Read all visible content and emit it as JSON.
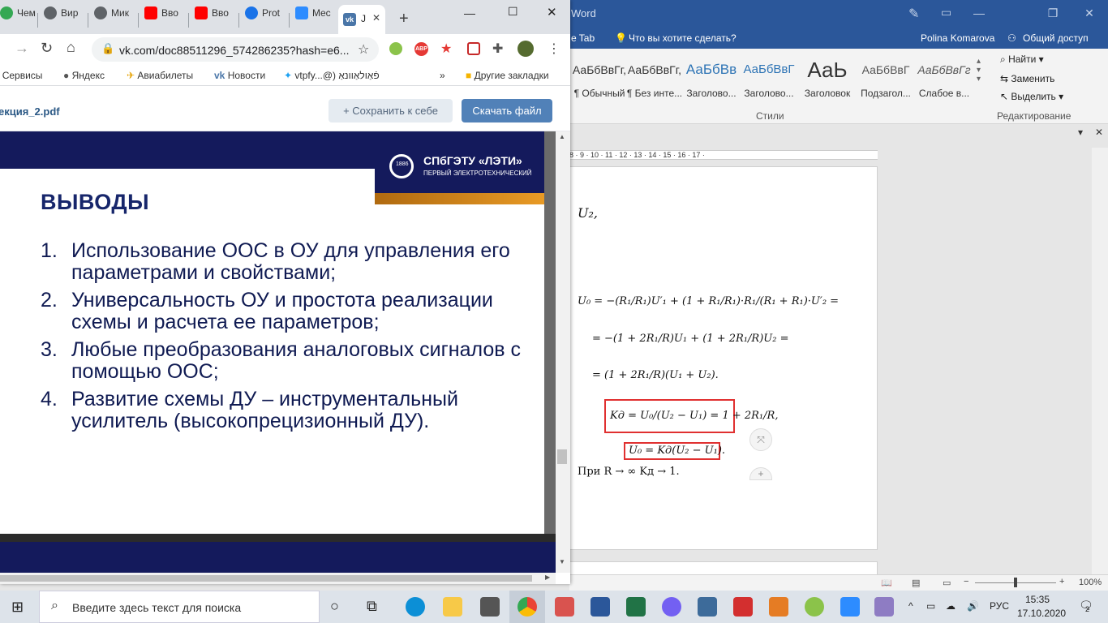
{
  "word": {
    "title_fragment": "Word",
    "tell_me": "Что вы хотите сделать?",
    "tab_fragment": "e Tab",
    "user": "Polina Komarova",
    "share": "Общий доступ",
    "styles": [
      {
        "sample": "АаБбВвГг,",
        "label": "¶ Обычный"
      },
      {
        "sample": "АаБбВвГг,",
        "label": "¶ Без инте..."
      },
      {
        "sample": "АаБбВв",
        "label": "Заголово..."
      },
      {
        "sample": "АаБбВвГ",
        "label": "Заголово..."
      },
      {
        "sample": "АаЬ",
        "label": "Заголовок"
      },
      {
        "sample": "АаБбВвГ",
        "label": "Подзагол..."
      },
      {
        "sample": "АаБбВвГг",
        "label": "Слабое в..."
      }
    ],
    "styles_group": "Стили",
    "editing": {
      "find": "Найти",
      "replace": "Заменить",
      "select": "Выделить",
      "group": "Редактирование"
    },
    "ruler": "8 · 9 · 10 · 11 · 12 · 13 · 14 · 15 · 16 · 17 ·",
    "equations": {
      "frag": "U₂,",
      "line1": "U₀ = −(R₁/R₁)U′₁ + (1 + R₁/R₁)·R₁/(R₁ + R₁)·U′₂ =",
      "line2": "= −(1 + 2R₁/R)U₁ + (1 + 2R₁/R)U₂ =",
      "line3": "= (1 + 2R₁/R)(U₁ + U₂).",
      "box1": "Kд = U₀/(U₂ − U₁) = 1 + 2R₁/R,",
      "box2": "U₀ = Kд(U₂ − U₁).",
      "note": "При R → ∞ Kд → 1."
    },
    "zoom": "100%"
  },
  "chrome": {
    "tabs": [
      "Чем",
      "Вир",
      "Мик",
      "Вво",
      "Вво",
      "Prot",
      "Mec",
      "J"
    ],
    "url": "vk.com/doc88511296_574286235?hash=e6...",
    "bookmarks": [
      "Сервисы",
      "Яндекс",
      "Авиабилеты",
      "Новости",
      "vtpfy...@) פֿאַולאַוונאַ",
      "Другие закладки"
    ],
    "file_name": "екция_2.pdf",
    "save_label": "Сохранить к себе",
    "download_label": "Скачать файл"
  },
  "slide": {
    "logo_title": "СПбГЭТУ «ЛЭТИ»",
    "logo_sub": "ПЕРВЫЙ ЭЛЕКТРОТЕХНИЧЕСКИЙ",
    "logo_year": "1886",
    "title": "ВЫВОДЫ",
    "items": [
      {
        "num": "1.",
        "text": "Использование ООС в ОУ для управления его параметрами и свойствами;"
      },
      {
        "num": "2.",
        "text": "Универсальность ОУ и простота реализации схемы и расчета ее параметров;"
      },
      {
        "num": "3.",
        "text": "Любые преобразования аналоговых сигналов с помощью ООС;"
      },
      {
        "num": "4.",
        "text": "Развитие схемы ДУ – инструментальный усилитель (высокопрецизионный ДУ)."
      }
    ]
  },
  "taskbar": {
    "search_placeholder": "Введите здесь текст для поиска",
    "lang": "РУС",
    "time": "15:35",
    "date": "17.10.2020",
    "notifications": "2"
  },
  "colors": {
    "word_blue": "#2b579a",
    "slide_navy": "#141a5c",
    "vk_blue": "#5181b8",
    "accent_orange": "#e89a25"
  }
}
